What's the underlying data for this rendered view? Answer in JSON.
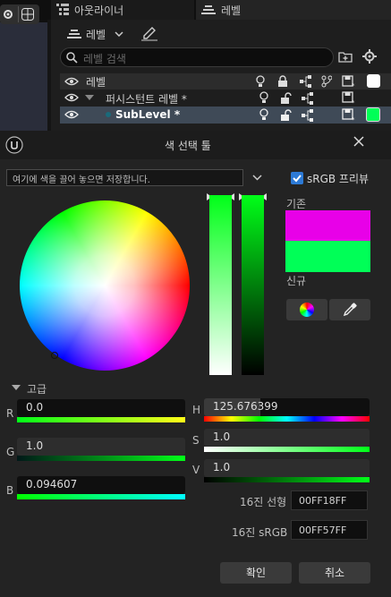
{
  "tabs": {
    "outliner": "아웃라이너",
    "levels": "레벨"
  },
  "levels_panel": {
    "toolbar_label": "레벨",
    "search_placeholder": "레벨 검색",
    "header_label": "레벨",
    "rows": [
      {
        "name": "퍼시스턴트 레벨 *"
      },
      {
        "name": "SubLevel *",
        "color": "#00ff57"
      }
    ]
  },
  "dialog": {
    "title": "색 선택 툴",
    "drop_hint": "여기에 색을 끌어 놓으면 저장합니다.",
    "srgb_preview": "sRGB 프리뷰",
    "old_label": "기존",
    "new_label": "신규",
    "old_color": "#e800e8",
    "new_color": "#00ff57",
    "advanced_label": "고급",
    "channels": {
      "r": {
        "label": "R",
        "value": "0.0"
      },
      "g": {
        "label": "G",
        "value": "1.0"
      },
      "b": {
        "label": "B",
        "value": "0.094607"
      },
      "h": {
        "label": "H",
        "value": "125.676399"
      },
      "s": {
        "label": "S",
        "value": "1.0"
      },
      "v": {
        "label": "V",
        "value": "1.0"
      }
    },
    "hex_linear_label": "16진 선형",
    "hex_linear": "00FF18FF",
    "hex_srgb_label": "16진 sRGB",
    "hex_srgb": "00FF57FF",
    "ok": "확인",
    "cancel": "취소"
  }
}
